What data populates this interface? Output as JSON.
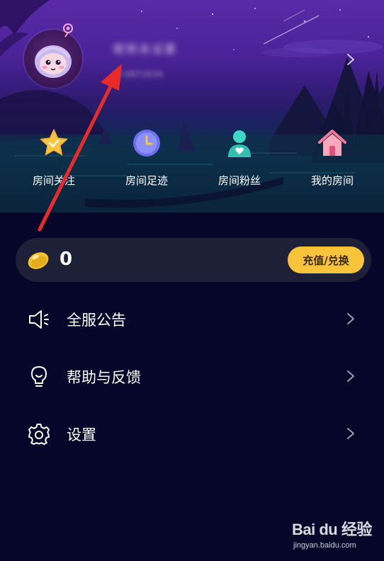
{
  "profile": {
    "username": "昵称未设置",
    "user_id": "ID:9872634"
  },
  "quick_nav": [
    {
      "label": "房间关注",
      "icon": "star-icon"
    },
    {
      "label": "房间足迹",
      "icon": "clock-icon"
    },
    {
      "label": "房间粉丝",
      "icon": "fan-user-icon"
    },
    {
      "label": "我的房间",
      "icon": "house-icon"
    }
  ],
  "wallet": {
    "coin_count": "0",
    "recharge_label": "充值/兑换",
    "coin_icon": "coin-bean-icon"
  },
  "menu": [
    {
      "label": "全服公告",
      "icon": "megaphone-icon"
    },
    {
      "label": "帮助与反馈",
      "icon": "lightbulb-icon"
    },
    {
      "label": "设置",
      "icon": "gear-icon"
    }
  ],
  "watermark": {
    "logo": "Bai du 经验",
    "url": "jingyan.baidu.com"
  },
  "colors": {
    "accent": "#f7c43b",
    "background": "#06062a",
    "coin_bar": "#1d2036",
    "annotation": "#e82a2a"
  }
}
